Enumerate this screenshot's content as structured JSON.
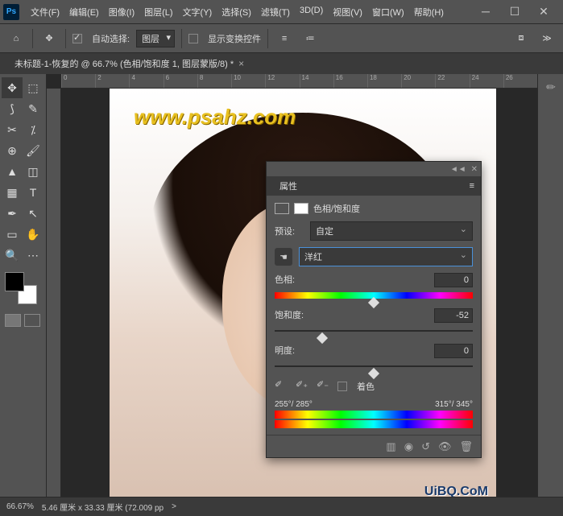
{
  "app": {
    "logo": "Ps"
  },
  "menu": [
    "文件(F)",
    "编辑(E)",
    "图像(I)",
    "图层(L)",
    "文字(Y)",
    "选择(S)",
    "滤镜(T)",
    "3D(D)",
    "视图(V)",
    "窗口(W)",
    "帮助(H)"
  ],
  "options": {
    "auto_select_label": "自动选择:",
    "target": "图层",
    "show_transform": "显示变换控件"
  },
  "tab": {
    "title": "未标题-1-恢复的 @ 66.7% (色相/饱和度 1, 图层蒙版/8) *"
  },
  "ruler_marks": [
    "0",
    "2",
    "4",
    "6",
    "8",
    "10",
    "12",
    "14",
    "16",
    "18",
    "20",
    "22",
    "24",
    "26"
  ],
  "watermarks": {
    "w1": "www.psahz.com",
    "w2": "UiBQ.CoM"
  },
  "status": {
    "zoom": "66.67%",
    "dims": "5.46 厘米 x 33.33 厘米 (72.009 pp",
    "arrow": ">"
  },
  "panel": {
    "title": "属性",
    "adj_label": "色相/饱和度",
    "preset_label": "预设:",
    "preset_value": "自定",
    "channel_value": "洋红",
    "hue": {
      "label": "色相:",
      "value": "0",
      "pos": 50
    },
    "sat": {
      "label": "饱和度:",
      "value": "-52",
      "pos": 24
    },
    "light": {
      "label": "明度:",
      "value": "0",
      "pos": 50
    },
    "colorize": "着色",
    "range_left": "255°/ 285°",
    "range_right": "315°/ 345°"
  }
}
